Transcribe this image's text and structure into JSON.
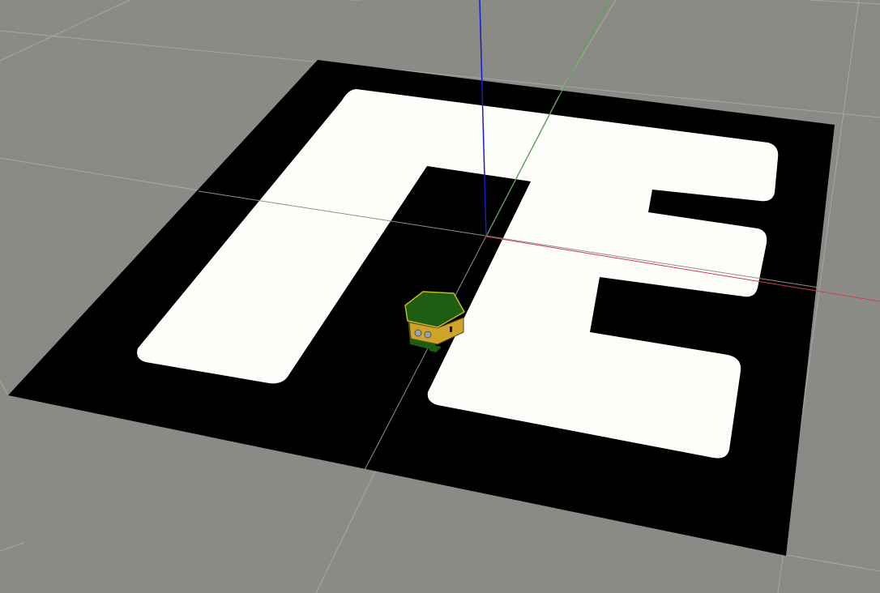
{
  "scene": {
    "ground_color": "#8a8a86",
    "grid_color": "#a7a7a3",
    "mat_color": "#000000",
    "track_color": "#fdfdf9",
    "robot_top_color": "#1f5d12",
    "robot_body_color": "#d0a32a",
    "axis_x_color": "#d13b4a",
    "axis_y_color": "#54a84d",
    "axis_z_color": "#1a1ad1"
  }
}
